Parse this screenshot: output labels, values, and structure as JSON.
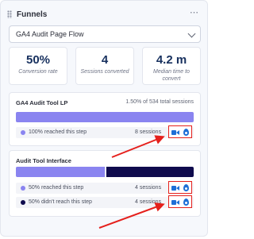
{
  "panel": {
    "title": "Funnels",
    "more_label": "⋯"
  },
  "funnel_select": {
    "value": "GA4 Audit Page Flow"
  },
  "stats": [
    {
      "value": "50%",
      "label": "Conversion rate"
    },
    {
      "value": "4",
      "label": "Sessions converted"
    },
    {
      "value": "4.2 m",
      "label": "Median time to convert"
    }
  ],
  "steps": [
    {
      "title": "GA4 Audit Tool LP",
      "meta": "1.50% of 534 total sessions",
      "bar_fraction": 1.0,
      "rows": [
        {
          "label": "100% reached this step",
          "sessions": "8 sessions",
          "dot_color": "#8a84f0"
        }
      ]
    },
    {
      "title": "Audit Tool Interface",
      "meta": "",
      "bar_fraction": 0.5,
      "rows": [
        {
          "label": "50% reached this step",
          "sessions": "4 sessions",
          "dot_color": "#8a84f0"
        },
        {
          "label": "50% didn't reach this step",
          "sessions": "4 sessions",
          "dot_color": "#0f0b4d"
        }
      ]
    }
  ],
  "colors": {
    "reached": "#8a84f0",
    "not_reached": "#0f0b4d",
    "icon_blue": "#1f6fd6",
    "highlight_red": "#e5201c"
  },
  "icons": [
    "drag-grip-icon",
    "more-icon",
    "chevron-down-icon",
    "video-camera-icon",
    "heatmap-flame-icon",
    "annotation-arrow-icon"
  ]
}
